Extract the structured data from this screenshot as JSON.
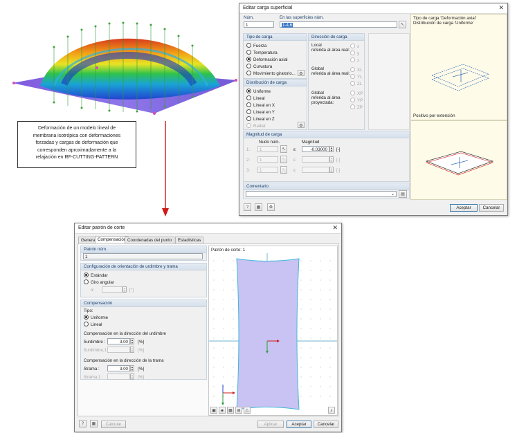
{
  "caption": {
    "lines": [
      "Deformación de un modelo lineal de",
      "membrana isotrópica con deformaciones",
      "forzadas y cargas de deformación que",
      "corresponden aproximadamente a la",
      "relajación en RF-CUTTING-PATTERN"
    ]
  },
  "load_dialog": {
    "title": "Editar carga superficial",
    "num_label": "Núm.",
    "num_value": "1",
    "surfaces_label": "En las superficies núm.",
    "surfaces_value": "1-4,6",
    "load_type": {
      "header": "Tipo de carga",
      "options": [
        "Fuerza",
        "Temperatura",
        "Deformación axial",
        "Curvatura",
        "Movimiento giratorio..."
      ],
      "selected": 2
    },
    "load_dir": {
      "header": "Dirección de carga",
      "local_label": "Local\nreferida al área real:",
      "local_opts": [
        "x",
        "y",
        "z"
      ],
      "global_label": "Global\nreferida al área real:",
      "global_opts": [
        "XL",
        "YL",
        "ZL"
      ],
      "proj_label": "Global\nreferida al área\nproyectada:",
      "proj_opts": [
        "XP",
        "YP",
        "ZP"
      ]
    },
    "load_dist": {
      "header": "Distribución de carga",
      "options": [
        "Uniforme",
        "Lineal",
        "Lineal en X",
        "Lineal en Y",
        "Lineal en Z",
        "Radial"
      ],
      "selected": 0
    },
    "preview_text": "Tipo de carga 'Deformación axial'\nDistribución de carga 'Uniforme'",
    "preview_positive": "Positivo por extensión",
    "magnitude": {
      "header": "Magnitud de carga",
      "node_label": "Nudo núm.",
      "mag_label": "Magnitud",
      "rows": [
        {
          "sym": "1:",
          "node": "1",
          "e": "ε:",
          "value": "-0.03000",
          "unit": "[-]"
        },
        {
          "sym": "2:",
          "node": "1",
          "e": "ε:",
          "value": "",
          "unit": "[-]"
        },
        {
          "sym": "3:",
          "node": "1",
          "e": "ε:",
          "value": "",
          "unit": "[-]"
        }
      ]
    },
    "comment_header": "Comentario",
    "ok": "Aceptar",
    "cancel": "Cancelar"
  },
  "cut_dialog": {
    "title": "Editar patrón de corte",
    "tabs": [
      "General",
      "Compensación",
      "Coordenadas del punto",
      "Estadísticas"
    ],
    "active_tab": 1,
    "pattern_header": "Patrón núm.",
    "pattern_value": "1",
    "warp_header": "Configuración de orientación de urdimbre y trama",
    "warp_opts": [
      "Estándar",
      "Giro angular"
    ],
    "angle_label": "α:",
    "angle_unit": "[°]",
    "comp_header": "Compensación",
    "type_label": "Tipo:",
    "type_opts": [
      "Uniforme",
      "Lineal"
    ],
    "warp_comp_label": "Compensación en la dirección del urdimbre",
    "warp_row1": {
      "label": "δurdimbre :",
      "value": "3.00",
      "unit": "[%]"
    },
    "warp_row2": {
      "label": "δurdimbre,1 :",
      "value": "",
      "unit": "[%]"
    },
    "weft_comp_label": "Compensación en la dirección de la trama",
    "weft_row1": {
      "label": "δtrama :",
      "value": "3.00",
      "unit": "[%]"
    },
    "weft_row2": {
      "label": "δtrama,1 :",
      "value": "",
      "unit": "[%]"
    },
    "canvas_title": "Patrón de corte: 1",
    "calc": "Calcular",
    "apply": "Aplicar",
    "ok": "Aceptar",
    "cancel": "Cancelar"
  },
  "colors": {
    "accent": "#1d3f6a",
    "pattern_fill": "#c8c3f2",
    "arrow": "#d01818"
  }
}
